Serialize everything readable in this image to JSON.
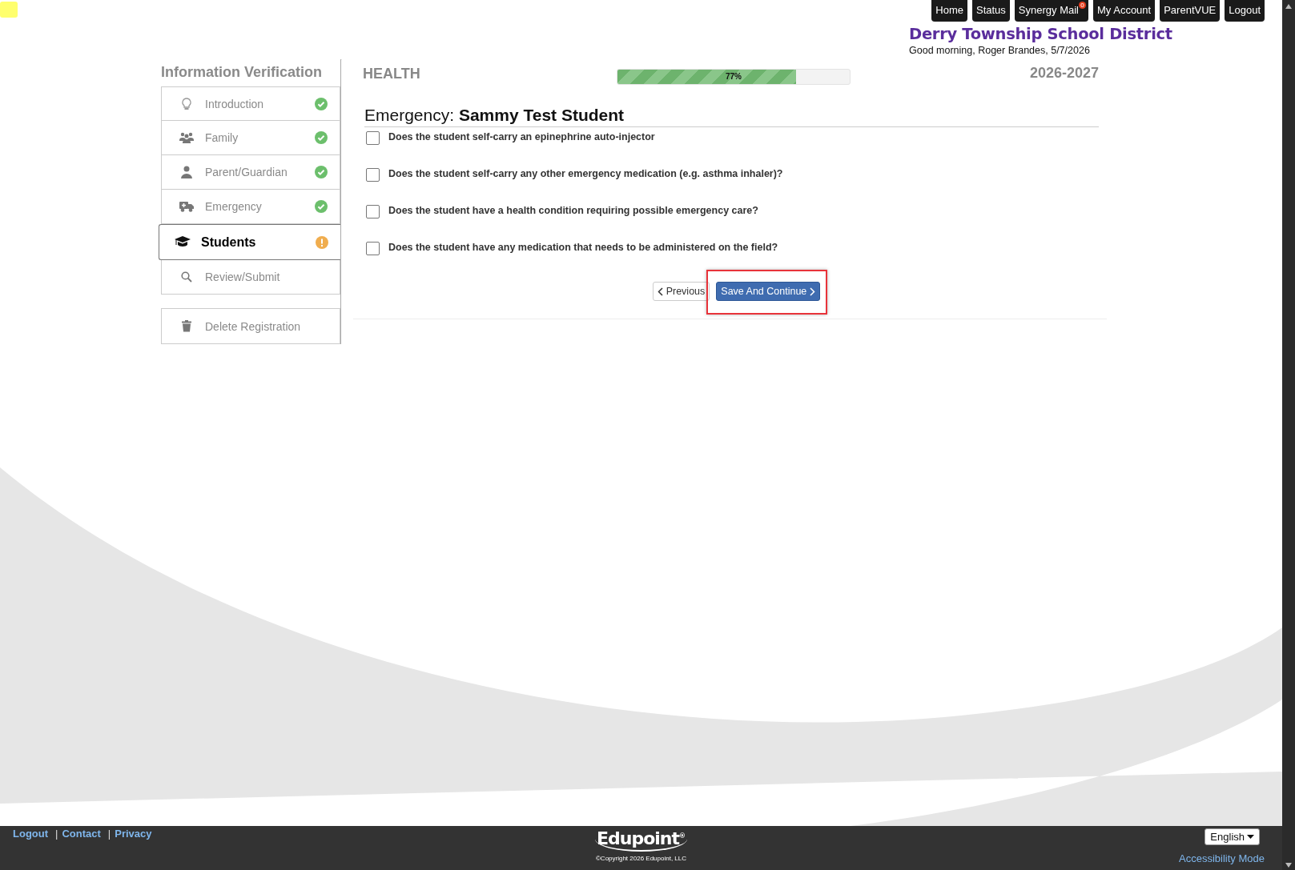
{
  "top_nav": [
    {
      "label": "Home"
    },
    {
      "label": "Status"
    },
    {
      "label": "Synergy Mail",
      "badge": "0"
    },
    {
      "label": "My Account"
    },
    {
      "label": "ParentVUE"
    },
    {
      "label": "Logout"
    }
  ],
  "header": {
    "district": "Derry Township School District",
    "greeting": "Good morning, Roger Brandes, 5/7/2026"
  },
  "sidebar": {
    "title": "Information Verification",
    "items": [
      {
        "label": "Introduction",
        "kind": "complete",
        "selected": false
      },
      {
        "label": "Family",
        "kind": "complete",
        "selected": false
      },
      {
        "label": "Parent/Guardian",
        "kind": "complete",
        "selected": false
      },
      {
        "label": "Emergency",
        "kind": "complete",
        "selected": false
      },
      {
        "label": "Students",
        "kind": "attention",
        "selected": true
      },
      {
        "label": "Review/Submit",
        "kind": "pending",
        "selected": false
      }
    ],
    "delete_button": "Delete Registration"
  },
  "main": {
    "section": "HEALTH",
    "progress": {
      "level": 0.77,
      "label": "77%"
    },
    "school_year": "2026-2027",
    "heading_prefix": "Emergency:",
    "heading_name": "Sammy Test Student",
    "questions": [
      {
        "label": "Does the student self-carry an epinephrine auto-injector",
        "checked": false
      },
      {
        "label": "Does the student self-carry any other emergency medication (e.g. asthma inhaler)?",
        "checked": false
      },
      {
        "label": "Does the student have a health condition requiring possible emergency care?",
        "checked": false
      },
      {
        "label": "Does the student have any medication that needs to be administered on the field?",
        "checked": false
      }
    ],
    "previous_button": "Previous",
    "save_button": {
      "label": "Save And Continue",
      "highlighted": true
    }
  },
  "footer": {
    "links": [
      {
        "label": "Logout"
      },
      {
        "separator": "|",
        "label": "Contact"
      },
      {
        "separator": "|",
        "label": "Privacy"
      }
    ],
    "logo": "Edupoint",
    "logo_mark": "®",
    "copyright": "©Copyright 2026 Edupoint, LLC",
    "language": "English",
    "accessibility": "Accessibility Mode"
  }
}
